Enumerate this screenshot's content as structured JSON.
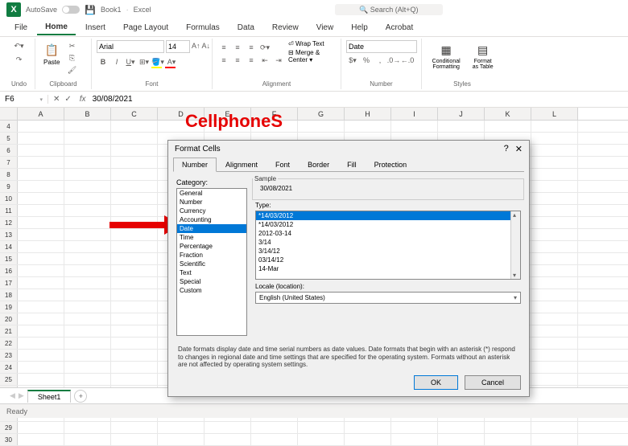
{
  "titlebar": {
    "autosave": "AutoSave",
    "book_name": "Book1",
    "app_name": "Excel",
    "search_placeholder": "Search (Alt+Q)"
  },
  "tabs": [
    "File",
    "Home",
    "Insert",
    "Page Layout",
    "Formulas",
    "Data",
    "Review",
    "View",
    "Help",
    "Acrobat"
  ],
  "active_tab": 1,
  "ribbon": {
    "undo_label": "Undo",
    "clipboard_label": "Clipboard",
    "paste_label": "Paste",
    "font_label": "Font",
    "font_name": "Arial",
    "font_size": "14",
    "alignment_label": "Alignment",
    "wrap_text": "Wrap Text",
    "merge_center": "Merge & Center",
    "number_label": "Number",
    "number_format": "Date",
    "styles_label": "Styles",
    "cond_format": "Conditional Formatting",
    "format_table": "Format as Table"
  },
  "formula_bar": {
    "cell_ref": "F6",
    "value": "30/08/2021"
  },
  "columns": [
    "A",
    "B",
    "C",
    "D",
    "E",
    "F",
    "G",
    "H",
    "I",
    "J",
    "K",
    "L"
  ],
  "rows_start": 4,
  "rows_end": 30,
  "watermark": "CellphoneS",
  "dialog": {
    "title": "Format Cells",
    "help_icon": "?",
    "tabs": [
      "Number",
      "Alignment",
      "Font",
      "Border",
      "Fill",
      "Protection"
    ],
    "active_tab": 0,
    "category_label": "Category:",
    "categories": [
      "General",
      "Number",
      "Currency",
      "Accounting",
      "Date",
      "Time",
      "Percentage",
      "Fraction",
      "Scientific",
      "Text",
      "Special",
      "Custom"
    ],
    "selected_category": 4,
    "sample_label": "Sample",
    "sample_value": "30/08/2021",
    "type_label": "Type:",
    "types": [
      "*14/03/2012",
      "*14/03/2012",
      "2012-03-14",
      "3/14",
      "3/14/12",
      "03/14/12",
      "14-Mar"
    ],
    "selected_type": 0,
    "locale_label": "Locale (location):",
    "locale_value": "English (United States)",
    "description": "Date formats display date and time serial numbers as date values. Date formats that begin with an asterisk (*) respond to changes in regional date and time settings that are specified for the operating system. Formats without an asterisk are not affected by operating system settings.",
    "ok": "OK",
    "cancel": "Cancel"
  },
  "sheet": {
    "sheet1": "Sheet1"
  },
  "status": {
    "ready": "Ready"
  }
}
